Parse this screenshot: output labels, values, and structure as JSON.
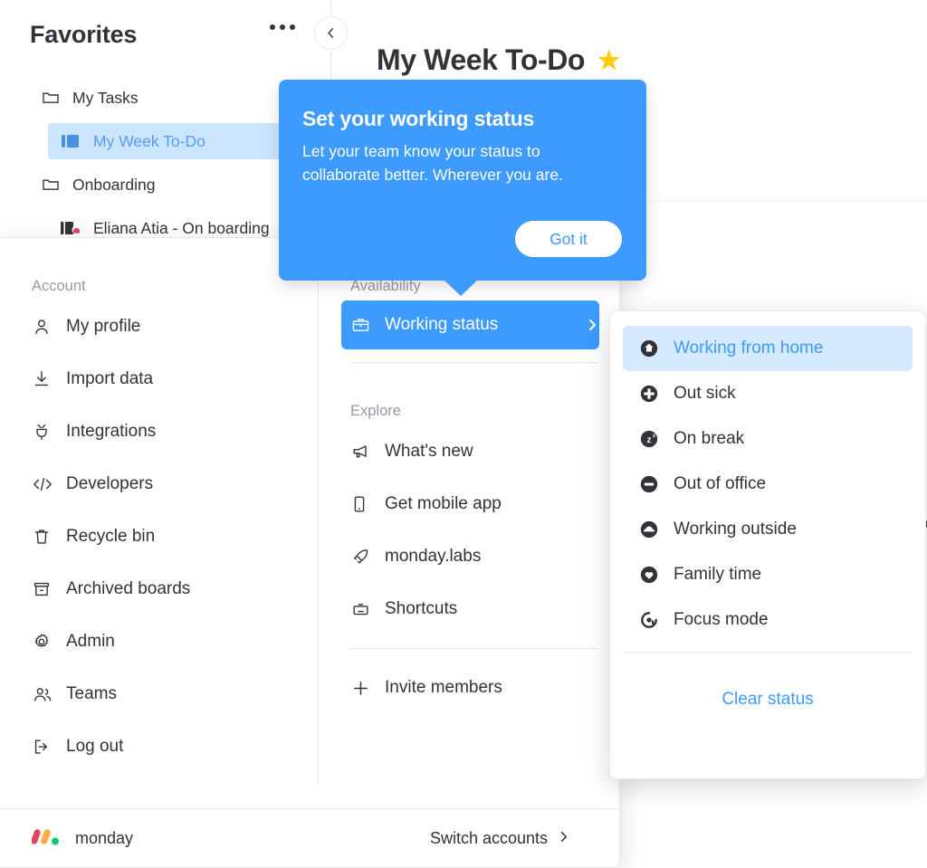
{
  "sidebar": {
    "title": "Favorites",
    "more_icon": "ellipsis-icon",
    "collapse_icon": "chevron-left-icon",
    "items": [
      {
        "label": "My Tasks",
        "icon": "folder-icon",
        "type": "folder"
      },
      {
        "label": "My Week To-Do",
        "icon": "board-icon",
        "type": "board",
        "active": true
      },
      {
        "label": "Onboarding",
        "icon": "folder-icon",
        "type": "folder"
      },
      {
        "label": "Eliana Atia - On boarding",
        "icon": "board-locked-icon",
        "type": "board"
      }
    ]
  },
  "main": {
    "title": "My Week To-Do",
    "favorite_icon": "star-icon",
    "favorite_color": "#FFCB00"
  },
  "tooltip": {
    "title": "Set your working status",
    "body": "Let your team know your status to collaborate better. Wherever you are.",
    "button": "Got it",
    "background": "#3d9aff"
  },
  "account_menu": {
    "left": {
      "section_label": "Account",
      "items": [
        {
          "label": "My profile",
          "icon": "person-icon"
        },
        {
          "label": "Import data",
          "icon": "download-icon"
        },
        {
          "label": "Integrations",
          "icon": "plug-icon"
        },
        {
          "label": "Developers",
          "icon": "code-icon"
        },
        {
          "label": "Recycle bin",
          "icon": "trash-icon"
        },
        {
          "label": "Archived boards",
          "icon": "archive-icon"
        },
        {
          "label": "Admin",
          "icon": "gear-icon"
        },
        {
          "label": "Teams",
          "icon": "people-icon"
        },
        {
          "label": "Log out",
          "icon": "logout-icon"
        }
      ]
    },
    "right": {
      "availability_label": "Availability",
      "working_status": {
        "label": "Working status",
        "icon": "briefcase-icon",
        "caret": "chevron-right-icon",
        "selected": true
      },
      "explore_label": "Explore",
      "explore_items": [
        {
          "label": "What's new",
          "icon": "megaphone-icon"
        },
        {
          "label": "Get mobile app",
          "icon": "mobile-icon"
        },
        {
          "label": "monday.labs",
          "icon": "rocket-icon"
        },
        {
          "label": "Shortcuts",
          "icon": "keyboard-icon"
        }
      ],
      "invite": {
        "label": "Invite members",
        "icon": "plus-icon"
      }
    },
    "footer": {
      "brand": "monday",
      "brand_icon": "monday-logo",
      "switch_label": "Switch accounts",
      "switch_icon": "chevron-right-icon"
    }
  },
  "status_menu": {
    "options": [
      {
        "label": "Working from home",
        "icon": "home-status-icon",
        "active": true
      },
      {
        "label": "Out sick",
        "icon": "medical-cross-icon",
        "active": false
      },
      {
        "label": "On break",
        "icon": "sleep-zz-icon",
        "active": false
      },
      {
        "label": "Out of office",
        "icon": "minus-circle-icon",
        "active": false
      },
      {
        "label": "Working outside",
        "icon": "cloud-icon",
        "active": false
      },
      {
        "label": "Family time",
        "icon": "heart-icon",
        "active": false
      },
      {
        "label": "Focus mode",
        "icon": "focus-target-icon",
        "active": false
      }
    ],
    "clear_label": "Clear status",
    "accent_color": "#3d9aff",
    "active_background": "#d6eaff"
  }
}
